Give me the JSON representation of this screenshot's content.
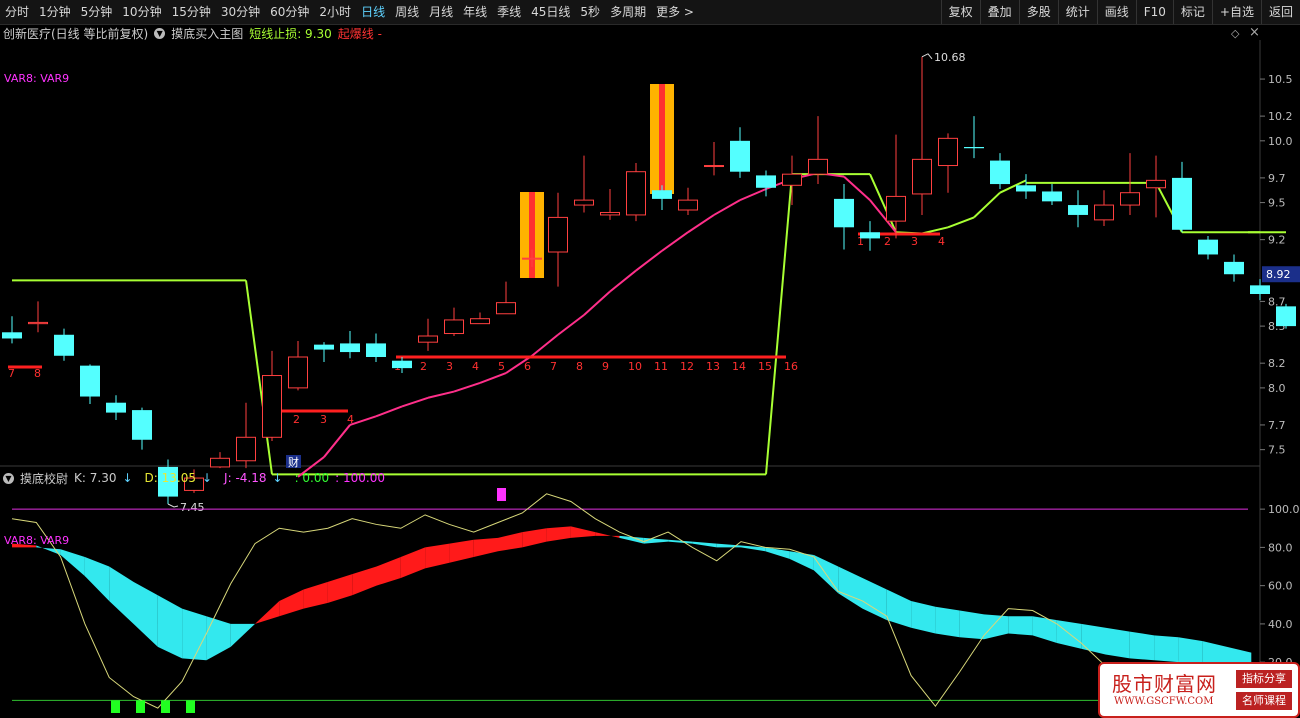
{
  "toolbar": {
    "periods": [
      "分时",
      "1分钟",
      "5分钟",
      "10分钟",
      "15分钟",
      "30分钟",
      "60分钟",
      "2小时",
      "日线",
      "周线",
      "月线",
      "年线",
      "季线",
      "45日线",
      "5秒",
      "多周期",
      "更多 >"
    ],
    "active_period": "日线",
    "right_buttons": [
      "复权",
      "叠加",
      "多股",
      "统计",
      "画线",
      "F10",
      "标记",
      "+自选",
      "返回"
    ]
  },
  "main_info": {
    "stock": "创新医疗(日线 等比前复权)",
    "indicator": "摸底买入主图",
    "stop_label": "短线止损: 9.30",
    "rise_label": "起爆线 -",
    "var_label": "VAR8: VAR9"
  },
  "lower_info": {
    "indicator": "摸底校尉",
    "k": "K: 7.30",
    "d": "D: 13.05",
    "j": "J: -4.18",
    "v1": ": 0.00",
    "v2": ": 100.00",
    "var_label": "VAR8: VAR9"
  },
  "price_axis": [
    "10.5",
    "10.2",
    "10.0",
    "9.7",
    "9.5",
    "9.2",
    "8.7",
    "8.5",
    "8.2",
    "8.0",
    "7.7",
    "7.5"
  ],
  "current_price": "8.92",
  "high_label": "10.68",
  "low_label": "7.45",
  "cai_label": "财",
  "count_labels": {
    "a": [
      "7",
      "8"
    ],
    "b": [
      "1",
      "2",
      "3",
      "4"
    ],
    "c": [
      "1",
      "2",
      "3",
      "4",
      "5",
      "6",
      "7",
      "8",
      "9",
      "10",
      "11",
      "12",
      "13",
      "14",
      "15",
      "16"
    ],
    "d": [
      "1",
      "2",
      "3",
      "4"
    ]
  },
  "kdj_axis": [
    "100.0",
    "80.0",
    "60.0",
    "40.0",
    "20.0"
  ],
  "colors": {
    "up": "#ff4040",
    "down": "#54ffff",
    "ma": "#ff2f8a",
    "stop": "#a8ff33",
    "kdj_bull": "#ff1a1a",
    "kdj_bear": "#33e8ee",
    "j_line": "#d8d87a",
    "signal": "#21ff21"
  },
  "chart_data": {
    "type": "candlestick",
    "candles": [
      [
        8.45,
        8.4,
        8.58,
        8.36
      ],
      [
        8.52,
        8.53,
        8.7,
        8.45
      ],
      [
        8.43,
        8.26,
        8.48,
        8.22
      ],
      [
        8.18,
        7.93,
        8.19,
        7.87
      ],
      [
        7.88,
        7.8,
        7.94,
        7.74
      ],
      [
        7.82,
        7.58,
        7.84,
        7.5
      ],
      [
        7.36,
        7.12,
        7.42,
        7.06
      ],
      [
        7.17,
        7.27,
        7.34,
        7.15
      ],
      [
        7.36,
        7.43,
        7.48,
        7.35
      ],
      [
        7.41,
        7.6,
        7.88,
        7.35
      ],
      [
        7.6,
        8.1,
        8.3,
        7.57
      ],
      [
        8.0,
        8.25,
        8.38,
        7.98
      ],
      [
        8.35,
        8.31,
        8.37,
        8.21
      ],
      [
        8.36,
        8.29,
        8.46,
        8.24
      ],
      [
        8.36,
        8.25,
        8.44,
        8.21
      ],
      [
        8.22,
        8.16,
        8.25,
        8.12
      ],
      [
        8.37,
        8.42,
        8.56,
        8.3
      ],
      [
        8.44,
        8.55,
        8.65,
        8.42
      ],
      [
        8.52,
        8.56,
        8.61,
        8.53
      ],
      [
        8.6,
        8.69,
        8.86,
        8.66
      ],
      [
        9.05,
        9.05,
        9.12,
        8.98
      ],
      [
        9.1,
        9.38,
        9.58,
        8.82
      ],
      [
        9.48,
        9.52,
        9.88,
        9.42
      ],
      [
        9.4,
        9.42,
        9.61,
        9.36
      ],
      [
        9.4,
        9.75,
        9.82,
        9.35
      ],
      [
        9.6,
        9.53,
        9.64,
        9.44
      ],
      [
        9.44,
        9.52,
        9.62,
        9.4
      ],
      [
        9.8,
        9.8,
        9.99,
        9.72
      ],
      [
        10.0,
        9.75,
        10.11,
        9.7
      ],
      [
        9.72,
        9.62,
        9.76,
        9.55
      ],
      [
        9.64,
        9.73,
        9.88,
        9.48
      ],
      [
        9.73,
        9.85,
        10.2,
        9.65
      ],
      [
        9.53,
        9.3,
        9.65,
        9.12
      ],
      [
        9.26,
        9.21,
        9.35,
        9.11
      ],
      [
        9.35,
        9.55,
        10.05,
        9.21
      ],
      [
        9.57,
        9.85,
        10.68,
        9.4
      ],
      [
        9.8,
        10.02,
        10.06,
        9.58
      ],
      [
        9.95,
        9.94,
        10.2,
        9.86
      ],
      [
        9.84,
        9.65,
        9.9,
        9.61
      ],
      [
        9.64,
        9.59,
        9.73,
        9.53
      ],
      [
        9.59,
        9.51,
        9.65,
        9.48
      ],
      [
        9.48,
        9.4,
        9.6,
        9.3
      ],
      [
        9.36,
        9.48,
        9.6,
        9.31
      ],
      [
        9.48,
        9.58,
        9.9,
        9.4
      ],
      [
        9.62,
        9.68,
        9.88,
        9.38
      ],
      [
        9.7,
        9.28,
        9.83,
        9.26
      ],
      [
        9.2,
        9.08,
        9.23,
        9.04
      ],
      [
        9.02,
        8.92,
        9.08,
        8.86
      ],
      [
        8.83,
        8.76,
        8.88,
        8.71
      ],
      [
        8.66,
        8.5,
        8.68,
        8.48
      ]
    ],
    "kdj": {
      "j": [
        95,
        93,
        75,
        40,
        12,
        2,
        -4,
        10,
        35,
        61,
        82,
        90,
        88,
        90,
        95,
        92,
        90,
        97,
        92,
        88,
        93,
        98,
        108,
        104,
        95,
        88,
        83,
        88,
        80,
        73,
        83,
        80,
        79,
        75,
        57,
        52,
        44,
        13,
        -3,
        15,
        34,
        48,
        47,
        40,
        30,
        18,
        12,
        16,
        20,
        10,
        3,
        -4
      ],
      "k": [
        82,
        81,
        76,
        65,
        52,
        40,
        28,
        22,
        21,
        28,
        40,
        52,
        58,
        62,
        66,
        70,
        75,
        80,
        82,
        84,
        85,
        88,
        90,
        91,
        88,
        85,
        82,
        83,
        82,
        80,
        80,
        78,
        74,
        68,
        56,
        48,
        42,
        38,
        35,
        33,
        32,
        35,
        34,
        30,
        27,
        24,
        22,
        21,
        20,
        18,
        15,
        12
      ],
      "d": [
        80,
        80,
        79,
        75,
        70,
        62,
        55,
        48,
        44,
        40,
        40,
        44,
        48,
        51,
        55,
        60,
        64,
        69,
        72,
        75,
        78,
        80,
        83,
        85,
        86,
        86,
        85,
        84,
        83,
        82,
        81,
        80,
        78,
        76,
        70,
        64,
        58,
        52,
        49,
        47,
        45,
        44,
        44,
        42,
        40,
        38,
        36,
        34,
        33,
        31,
        28,
        25
      ]
    },
    "ma": [
      null,
      null,
      null,
      null,
      null,
      null,
      null,
      null,
      null,
      null,
      null,
      7.28,
      7.44,
      7.7,
      7.77,
      7.85,
      7.92,
      7.97,
      8.04,
      8.12,
      8.26,
      8.43,
      8.59,
      8.78,
      8.95,
      9.11,
      9.26,
      9.4,
      9.52,
      9.61,
      9.69,
      9.74,
      9.71,
      9.52,
      9.26,
      9.25,
      9.3,
      9.38,
      9.58,
      9.68,
      null,
      null,
      null,
      null,
      null,
      null,
      null,
      null,
      null,
      null
    ],
    "stop_line": [
      8.87,
      8.87,
      8.87,
      8.87,
      8.87,
      8.87,
      8.87,
      8.87,
      8.87,
      8.87,
      7.3,
      7.3,
      7.3,
      7.3,
      7.3,
      7.3,
      7.3,
      7.3,
      7.3,
      7.3,
      7.3,
      7.3,
      7.3,
      7.3,
      7.3,
      7.3,
      7.3,
      7.3,
      7.3,
      7.3,
      9.73,
      9.73,
      9.73,
      9.73,
      9.26,
      null,
      null,
      null,
      null,
      9.66,
      9.66,
      9.66,
      9.66,
      9.66,
      9.66,
      9.26,
      9.26,
      9.26,
      9.26,
      9.26
    ],
    "ylim": [
      7.4,
      10.8
    ],
    "kdj_ylim": [
      -5,
      110
    ]
  }
}
